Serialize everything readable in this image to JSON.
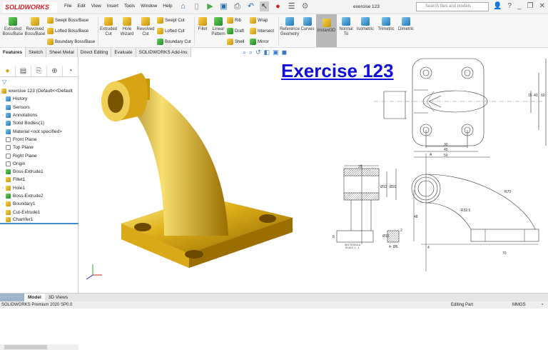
{
  "app": {
    "logo": "SOLIDWORKS",
    "title": "exercise 123",
    "search_placeholder": "Search files and models"
  },
  "menu": [
    "File",
    "Edit",
    "View",
    "Insert",
    "Tools",
    "Window",
    "Help"
  ],
  "ribbon": {
    "extruded_boss": "Extruded Boss/Base",
    "revolved_boss": "Revolved Boss/Base",
    "swept_boss": "Swept Boss/Base",
    "lofted_boss": "Lofted Boss/Base",
    "boundary_boss": "Boundary Boss/Base",
    "extruded_cut": "Extruded Cut",
    "hole_wizard": "Hole Wizard",
    "revolved_cut": "Revolved Cut",
    "swept_cut": "Swept Cut",
    "lofted_cut": "Lofted Cut",
    "boundary_cut": "Boundary Cut",
    "fillet": "Fillet",
    "linear_pattern": "Linear Pattern",
    "rib": "Rib",
    "draft": "Draft",
    "shell": "Shell",
    "wrap": "Wrap",
    "intersect": "Intersect",
    "mirror": "Mirror",
    "reference_geometry": "Reference Geometry",
    "curves": "Curves",
    "instant3d": "Instant3D",
    "normal_to": "Normal To",
    "isometric": "Isometric",
    "trimetric": "Trimetric",
    "dimetric": "Dimetric"
  },
  "tabs": [
    "Features",
    "Sketch",
    "Sheet Metal",
    "Direct Editing",
    "Evaluate",
    "SOLIDWORKS Add-Ins"
  ],
  "tree": {
    "root": "exercise 123  (Default<<Default",
    "items": [
      "History",
      "Sensors",
      "Annotations",
      "Solid Bodies(1)",
      "Material <not specified>",
      "Front Plane",
      "Top Plane",
      "Right Plane",
      "Origin",
      "Boss-Extrude1",
      "Fillet1",
      "Hole1",
      "Boss-Extrude2",
      "Boundary1",
      "Cut-Extrude1",
      "Chamfer1"
    ]
  },
  "viewport": {
    "heading": "Exercise 123",
    "dims": {
      "d15": "15",
      "d40": "40",
      "d60": "60",
      "d30": "30",
      "d45": "45",
      "d50": "50",
      "d25": "25",
      "dia12": "Ø12",
      "dia20": "Ø20",
      "dia10": "Ø10",
      "holes": "4- Ø6",
      "d8": "8",
      "d2": "2",
      "r70": "R70",
      "r325": "R32.5",
      "d48": "48",
      "d70": "70",
      "d4": "4",
      "section": "SECTION A-A",
      "scale": "SCALE 1 : 1",
      "a": "A"
    }
  },
  "bottom_tabs": [
    "Model",
    "3D Views"
  ],
  "status": {
    "product": "SOLIDWORKS Premium 2020 SP0.0",
    "mode": "Editing Part",
    "units": "MMGS"
  }
}
